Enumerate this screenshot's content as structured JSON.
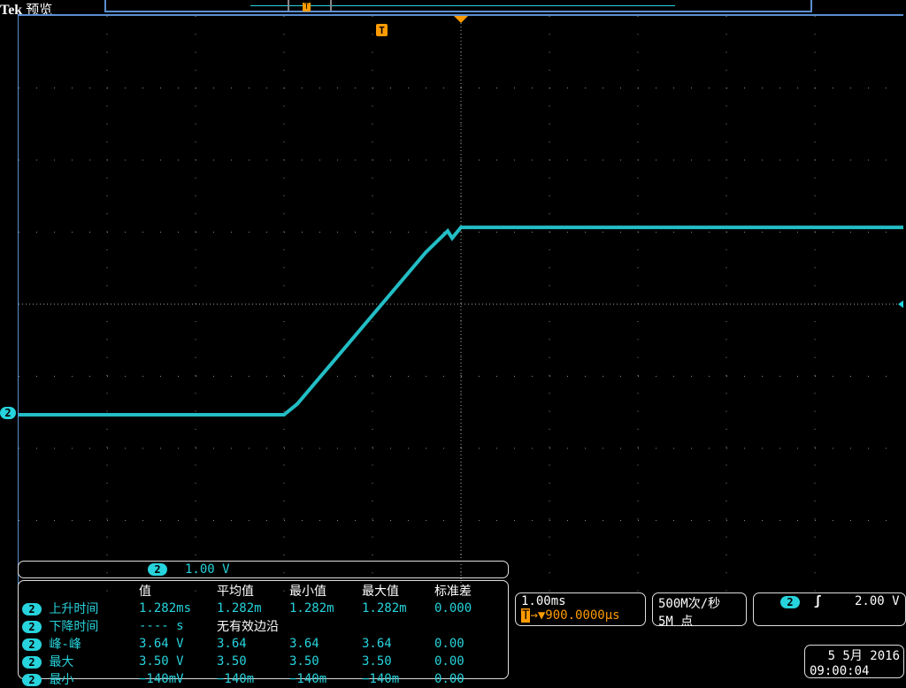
{
  "header": {
    "brand": "Tek",
    "mode": "预览"
  },
  "colors": {
    "channel2": "#27d3dc",
    "trigger": "#ff9b00",
    "frame": "#5b8fd0"
  },
  "channel": {
    "number": "2",
    "scale": "1.00 V"
  },
  "measurements": {
    "columns": [
      "值",
      "平均值",
      "最小值",
      "最大值",
      "标准差"
    ],
    "rows": [
      {
        "ch": "2",
        "name": "上升时间",
        "values": [
          "1.282ms",
          "1.282m",
          "1.282m",
          "1.282m",
          "0.000"
        ]
      },
      {
        "ch": "2",
        "name": "下降时间",
        "values": [
          "---- s",
          "无有效边沿",
          "",
          "",
          ""
        ]
      },
      {
        "ch": "2",
        "name": "峰-峰",
        "values": [
          "3.64 V",
          "3.64",
          "3.64",
          "3.64",
          "0.00"
        ]
      },
      {
        "ch": "2",
        "name": "最大",
        "values": [
          "3.50 V",
          "3.50",
          "3.50",
          "3.50",
          "0.00"
        ]
      },
      {
        "ch": "2",
        "name": "最小",
        "values": [
          "−140mV",
          "−140m",
          "−140m",
          "−140m",
          "0.00"
        ]
      }
    ]
  },
  "timebase": {
    "scale": "1.00ms",
    "trigger_icon": "T",
    "delay": "→▼900.0000µs"
  },
  "acquisition": {
    "rate": "500M次/秒",
    "points": "5M 点"
  },
  "trigger": {
    "ch": "2",
    "slope_icon": "rising-edge",
    "level": "2.00 V"
  },
  "datetime": {
    "date": "5 5月  2016",
    "time": "09:00:04"
  },
  "trace": {
    "time_ms": [
      0,
      3.0,
      3.15,
      4.6,
      4.85,
      4.9,
      5.0,
      5.5,
      10
    ],
    "volts": [
      0,
      0,
      0.15,
      2.25,
      2.55,
      2.45,
      2.6,
      2.6,
      2.6
    ]
  }
}
